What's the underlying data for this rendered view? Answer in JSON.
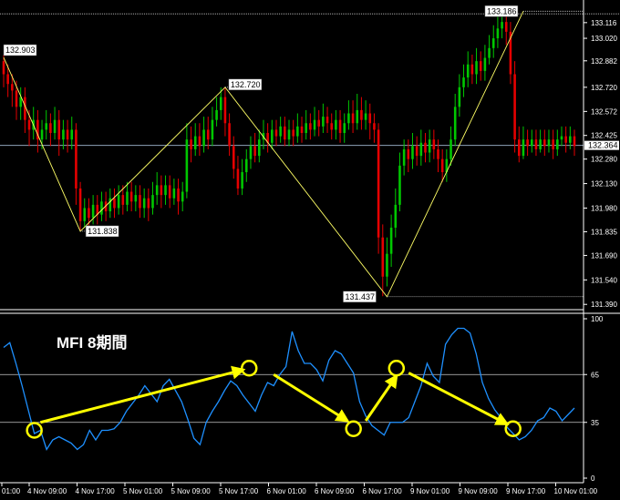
{
  "colors": {
    "background": "#000000",
    "bull": "#00c800",
    "bear": "#e60000",
    "zigzag": "#ffff66",
    "mfi": "#1e90ff",
    "arrow": "#ffff00",
    "grid": "#c8c8c8",
    "box_bg": "#ffffff"
  },
  "indicator": {
    "title": "MFI 8期間"
  },
  "chart_data": [
    {
      "type": "candlestick",
      "ylim": [
        131.38,
        133.21
      ],
      "y_ticks": [
        "133.116",
        "133.020",
        "132.882",
        "132.720",
        "132.572",
        "132.425",
        "132.280",
        "132.130",
        "131.980",
        "131.835",
        "131.690",
        "131.540",
        "131.390"
      ],
      "current_price": {
        "value": 132.364,
        "label": "132.364"
      },
      "top_line": 133.17,
      "zigzag": [
        {
          "i": 0,
          "price": 132.903,
          "label": "132.903"
        },
        {
          "i": 18,
          "price": 131.838,
          "label": "131.838"
        },
        {
          "i": 52,
          "price": 132.72,
          "label": "132.720"
        },
        {
          "i": 90,
          "price": 131.437,
          "label": "131.437"
        },
        {
          "i": 122,
          "price": 133.186,
          "label": "133.186"
        }
      ],
      "candles": [
        [
          132.88,
          132.8,
          132.92,
          132.72
        ],
        [
          132.8,
          132.74,
          132.86,
          132.66
        ],
        [
          132.74,
          132.7,
          132.8,
          132.6
        ],
        [
          132.7,
          132.6,
          132.76,
          132.52
        ],
        [
          132.6,
          132.66,
          132.72,
          132.52
        ],
        [
          132.66,
          132.52,
          132.72,
          132.44
        ],
        [
          132.52,
          132.46,
          132.58,
          132.36
        ],
        [
          132.46,
          132.52,
          132.6,
          132.4
        ],
        [
          132.52,
          132.4,
          132.58,
          132.32
        ],
        [
          132.4,
          132.46,
          132.52,
          132.34
        ],
        [
          132.46,
          132.5,
          132.58,
          132.4
        ],
        [
          132.5,
          132.44,
          132.56,
          132.36
        ],
        [
          132.44,
          132.52,
          132.6,
          132.4
        ],
        [
          132.52,
          132.4,
          132.58,
          132.3
        ],
        [
          132.4,
          132.46,
          132.52,
          132.34
        ],
        [
          132.46,
          132.4,
          132.52,
          132.32
        ],
        [
          132.4,
          132.46,
          132.54,
          132.34
        ],
        [
          132.46,
          132.1,
          132.5,
          132.0
        ],
        [
          132.1,
          131.9,
          132.14,
          131.84
        ],
        [
          131.9,
          131.98,
          132.04,
          131.86
        ],
        [
          131.98,
          131.92,
          132.04,
          131.86
        ],
        [
          131.92,
          132.0,
          132.06,
          131.88
        ],
        [
          132.0,
          131.94,
          132.06,
          131.88
        ],
        [
          131.94,
          132.02,
          132.08,
          131.9
        ],
        [
          132.02,
          131.96,
          132.08,
          131.9
        ],
        [
          131.96,
          132.04,
          132.1,
          131.92
        ],
        [
          132.04,
          131.98,
          132.1,
          131.92
        ],
        [
          131.98,
          132.06,
          132.12,
          131.94
        ],
        [
          132.06,
          132.0,
          132.12,
          131.94
        ],
        [
          132.0,
          132.08,
          132.14,
          131.96
        ],
        [
          132.08,
          132.02,
          132.14,
          131.96
        ],
        [
          132.02,
          132.06,
          132.12,
          131.96
        ],
        [
          132.06,
          131.98,
          132.12,
          131.92
        ],
        [
          131.98,
          132.04,
          132.1,
          131.92
        ],
        [
          132.04,
          131.98,
          132.1,
          131.9
        ],
        [
          131.98,
          132.06,
          132.14,
          131.94
        ],
        [
          132.06,
          132.12,
          132.2,
          132.0
        ],
        [
          132.12,
          132.06,
          132.18,
          131.98
        ],
        [
          132.06,
          132.12,
          132.18,
          132.0
        ],
        [
          132.12,
          132.04,
          132.18,
          131.98
        ],
        [
          132.04,
          132.1,
          132.16,
          132.0
        ],
        [
          132.1,
          132.02,
          132.16,
          131.94
        ],
        [
          132.02,
          132.08,
          132.14,
          131.96
        ],
        [
          132.08,
          132.4,
          132.5,
          132.04
        ],
        [
          132.4,
          132.34,
          132.48,
          132.26
        ],
        [
          132.34,
          132.42,
          132.5,
          132.3
        ],
        [
          132.42,
          132.36,
          132.5,
          132.3
        ],
        [
          132.36,
          132.46,
          132.54,
          132.32
        ],
        [
          132.46,
          132.4,
          132.54,
          132.34
        ],
        [
          132.4,
          132.52,
          132.6,
          132.36
        ],
        [
          132.52,
          132.58,
          132.66,
          132.48
        ],
        [
          132.58,
          132.66,
          132.72,
          132.52
        ],
        [
          132.66,
          132.5,
          132.72,
          132.42
        ],
        [
          132.5,
          132.36,
          132.56,
          132.3
        ],
        [
          132.36,
          132.22,
          132.42,
          132.16
        ],
        [
          132.22,
          132.1,
          132.3,
          132.06
        ],
        [
          132.1,
          132.2,
          132.28,
          132.06
        ],
        [
          132.2,
          132.28,
          132.34,
          132.14
        ],
        [
          132.28,
          132.36,
          132.42,
          132.22
        ],
        [
          132.36,
          132.3,
          132.44,
          132.26
        ],
        [
          132.3,
          132.4,
          132.46,
          132.26
        ],
        [
          132.4,
          132.44,
          132.52,
          132.34
        ],
        [
          132.44,
          132.38,
          132.5,
          132.32
        ],
        [
          132.38,
          132.46,
          132.52,
          132.34
        ],
        [
          132.46,
          132.42,
          132.52,
          132.36
        ],
        [
          132.42,
          132.48,
          132.54,
          132.38
        ],
        [
          132.48,
          132.4,
          132.54,
          132.36
        ],
        [
          132.4,
          132.46,
          132.52,
          132.36
        ],
        [
          132.46,
          132.42,
          132.52,
          132.36
        ],
        [
          132.42,
          132.48,
          132.56,
          132.38
        ],
        [
          132.48,
          132.44,
          132.54,
          132.38
        ],
        [
          132.44,
          132.5,
          132.58,
          132.4
        ],
        [
          132.5,
          132.46,
          132.56,
          132.4
        ],
        [
          132.46,
          132.52,
          132.6,
          132.42
        ],
        [
          132.52,
          132.48,
          132.58,
          132.42
        ],
        [
          132.48,
          132.54,
          132.62,
          132.44
        ],
        [
          132.54,
          132.5,
          132.6,
          132.44
        ],
        [
          132.5,
          132.46,
          132.56,
          132.4
        ],
        [
          132.46,
          132.52,
          132.58,
          132.4
        ],
        [
          132.52,
          132.44,
          132.58,
          132.38
        ],
        [
          132.44,
          132.5,
          132.56,
          132.38
        ],
        [
          132.5,
          132.56,
          132.64,
          132.46
        ],
        [
          132.56,
          132.5,
          132.64,
          132.44
        ],
        [
          132.5,
          132.58,
          132.68,
          132.46
        ],
        [
          132.58,
          132.52,
          132.66,
          132.46
        ],
        [
          132.52,
          132.56,
          132.64,
          132.46
        ],
        [
          132.56,
          132.5,
          132.62,
          132.4
        ],
        [
          132.5,
          132.46,
          132.56,
          132.38
        ],
        [
          132.46,
          131.8,
          132.5,
          131.7
        ],
        [
          131.8,
          131.56,
          131.88,
          131.44
        ],
        [
          131.56,
          131.7,
          131.8,
          131.5
        ],
        [
          131.7,
          131.86,
          131.94,
          131.62
        ],
        [
          131.86,
          132.0,
          132.1,
          131.8
        ],
        [
          132.0,
          132.24,
          132.32,
          131.96
        ],
        [
          132.24,
          132.34,
          132.4,
          132.18
        ],
        [
          132.34,
          132.28,
          132.4,
          132.2
        ],
        [
          132.28,
          132.36,
          132.44,
          132.22
        ],
        [
          132.36,
          132.3,
          132.42,
          132.24
        ],
        [
          132.3,
          132.38,
          132.46,
          132.24
        ],
        [
          132.38,
          132.32,
          132.44,
          132.26
        ],
        [
          132.32,
          132.4,
          132.46,
          132.26
        ],
        [
          132.4,
          132.34,
          132.46,
          132.28
        ],
        [
          132.34,
          132.28,
          132.4,
          132.2
        ],
        [
          132.28,
          132.2,
          132.34,
          132.14
        ],
        [
          132.2,
          132.28,
          132.34,
          132.14
        ],
        [
          132.28,
          132.4,
          132.48,
          132.24
        ],
        [
          132.4,
          132.6,
          132.68,
          132.36
        ],
        [
          132.6,
          132.72,
          132.8,
          132.54
        ],
        [
          132.72,
          132.78,
          132.86,
          132.66
        ],
        [
          132.78,
          132.86,
          132.94,
          132.72
        ],
        [
          132.86,
          132.8,
          132.92,
          132.74
        ],
        [
          132.8,
          132.88,
          132.96,
          132.74
        ],
        [
          132.88,
          132.82,
          132.94,
          132.76
        ],
        [
          132.82,
          132.9,
          132.98,
          132.76
        ],
        [
          132.9,
          132.96,
          133.04,
          132.86
        ],
        [
          132.96,
          133.02,
          133.1,
          132.9
        ],
        [
          133.02,
          133.08,
          133.16,
          132.96
        ],
        [
          133.08,
          133.12,
          133.19,
          133.02
        ],
        [
          133.12,
          133.06,
          133.16,
          132.98
        ],
        [
          133.06,
          132.8,
          133.12,
          132.74
        ],
        [
          132.8,
          132.4,
          132.88,
          132.32
        ],
        [
          132.4,
          132.3,
          132.48,
          132.26
        ],
        [
          132.3,
          132.4,
          132.48,
          132.28
        ],
        [
          132.4,
          132.36,
          132.46,
          132.3
        ],
        [
          132.36,
          132.4,
          132.46,
          132.32
        ],
        [
          132.4,
          132.34,
          132.46,
          132.3
        ],
        [
          132.34,
          132.4,
          132.46,
          132.32
        ],
        [
          132.4,
          132.36,
          132.46,
          132.3
        ],
        [
          132.36,
          132.4,
          132.46,
          132.32
        ],
        [
          132.4,
          132.34,
          132.46,
          132.28
        ],
        [
          132.34,
          132.4,
          132.46,
          132.3
        ],
        [
          132.4,
          132.42,
          132.48,
          132.36
        ],
        [
          132.42,
          132.38,
          132.48,
          132.32
        ],
        [
          132.38,
          132.42,
          132.48,
          132.34
        ],
        [
          132.42,
          132.36,
          132.46,
          132.3
        ]
      ]
    },
    {
      "type": "line",
      "name": "",
      "ylim": [
        0,
        100
      ],
      "y_ticks": [
        {
          "value": 100,
          "label": "100"
        },
        {
          "value": 65,
          "label": "65"
        },
        {
          "value": 35,
          "label": "35"
        },
        {
          "value": 0,
          "label": "0"
        }
      ],
      "levels": [
        65,
        35
      ],
      "values": [
        82,
        85,
        72,
        58,
        43,
        28,
        30,
        18,
        24,
        26,
        24,
        22,
        18,
        21,
        30,
        24,
        30,
        30,
        31,
        35,
        42,
        47,
        52,
        58,
        53,
        48,
        58,
        62,
        55,
        48,
        37,
        25,
        21,
        35,
        42,
        48,
        55,
        61,
        58,
        52,
        47,
        42,
        52,
        60,
        58,
        65,
        70,
        92,
        80,
        72,
        72,
        68,
        61,
        74,
        80,
        78,
        72,
        66,
        48,
        39,
        33,
        30,
        27,
        35,
        35,
        35,
        38,
        48,
        58,
        72,
        64,
        60,
        84,
        90,
        94,
        94,
        91,
        78,
        60,
        50,
        43,
        38,
        32,
        28,
        24,
        26,
        30,
        36,
        38,
        44,
        42,
        36,
        40,
        44
      ],
      "circles": [
        {
          "i": 5,
          "v": 30
        },
        {
          "i": 40,
          "v": 69
        },
        {
          "i": 57,
          "v": 31
        },
        {
          "i": 64,
          "v": 69
        },
        {
          "i": 83,
          "v": 31
        }
      ],
      "arrows": [
        {
          "from": {
            "i": 6,
            "v": 35
          },
          "to": {
            "i": 39,
            "v": 68
          }
        },
        {
          "from": {
            "i": 44,
            "v": 65
          },
          "to": {
            "i": 56,
            "v": 36
          }
        },
        {
          "from": {
            "i": 59,
            "v": 36
          },
          "to": {
            "i": 64,
            "v": 64
          }
        },
        {
          "from": {
            "i": 66,
            "v": 66
          },
          "to": {
            "i": 82,
            "v": 34
          }
        }
      ]
    }
  ],
  "time_axis": {
    "labels": [
      "01:00",
      "4 Nov 09:00",
      "4 Nov 17:00",
      "5 Nov 01:00",
      "5 Nov 09:00",
      "5 Nov 17:00",
      "6 Nov 01:00",
      "6 Nov 09:00",
      "6 Nov 17:00",
      "9 Nov 01:00",
      "9 Nov 09:00",
      "9 Nov 17:00",
      "10 Nov 01:00"
    ]
  }
}
